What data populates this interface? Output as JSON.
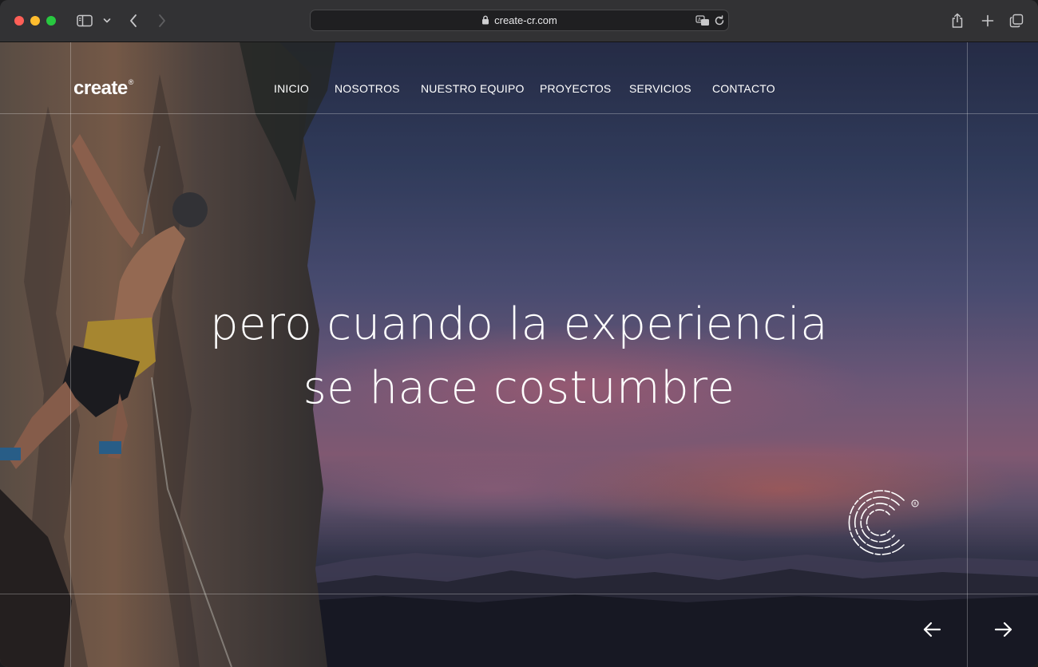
{
  "browser": {
    "url": "create-cr.com"
  },
  "site": {
    "logo_text": "create",
    "logo_mark": "®",
    "nav": [
      {
        "label": "INICIO"
      },
      {
        "label": "NOSOTROS"
      },
      {
        "label": "NUESTRO EQUIPO"
      },
      {
        "label": "PROYECTOS"
      },
      {
        "label": "SERVICIOS"
      },
      {
        "label": "CONTACTO"
      }
    ],
    "headline_line1": "pero cuando la experiencia",
    "headline_line2": "se hace costumbre"
  },
  "icons": {
    "sidebar": "sidebar-icon",
    "tab_overview": "chevron-down-icon",
    "back": "chevron-left-icon",
    "forward": "chevron-right-icon",
    "lock": "lock-icon",
    "translate": "translate-icon",
    "reload": "reload-icon",
    "share": "share-icon",
    "new_tab": "plus-icon",
    "tabs": "tabs-icon",
    "prev_slide": "arrow-left-icon",
    "next_slide": "arrow-right-icon",
    "brand_emblem": "c-emblem-icon"
  },
  "colors": {
    "traffic_red": "#ff5f57",
    "traffic_yellow": "#febc2e",
    "traffic_green": "#28c840",
    "toolbar": "#323234",
    "text_on_hero": "#ffffff"
  }
}
